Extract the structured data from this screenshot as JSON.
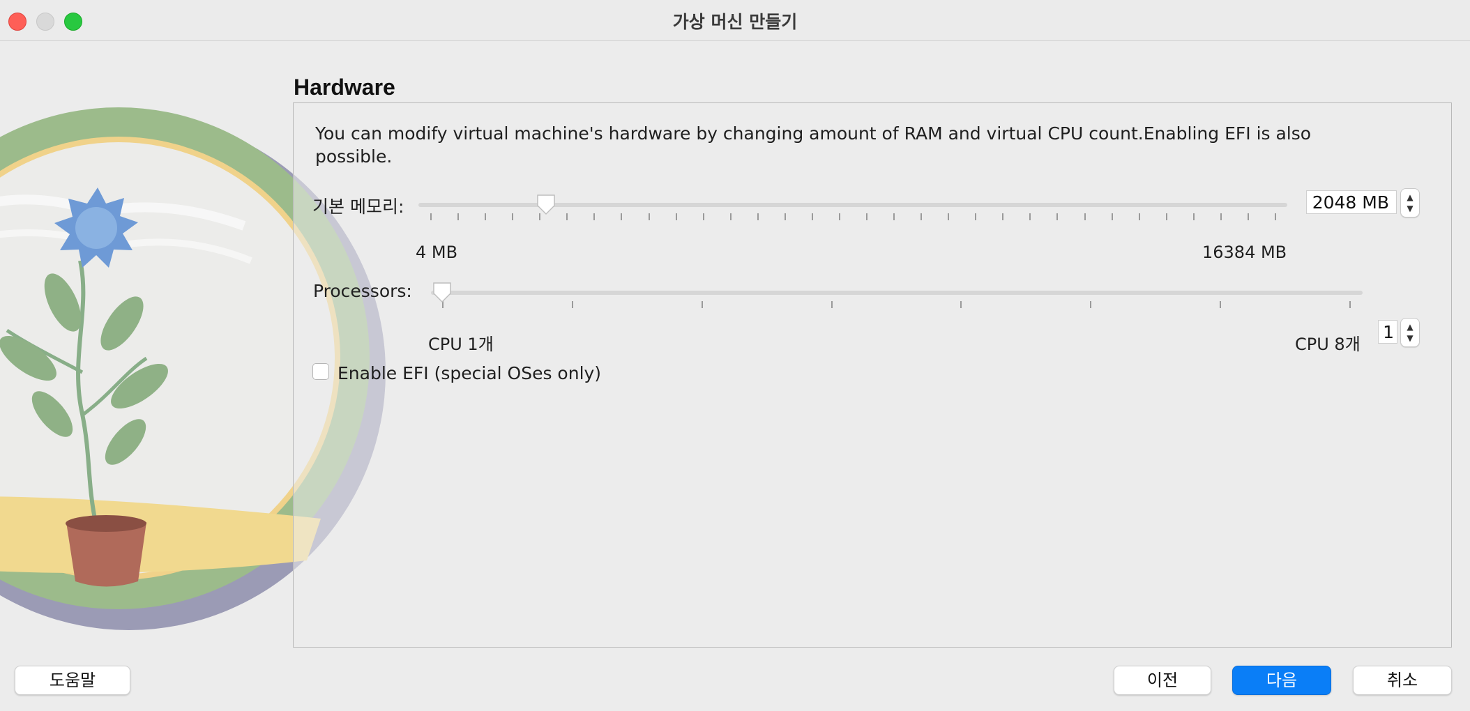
{
  "window": {
    "title": "가상 머신 만들기"
  },
  "page": {
    "title": "Hardware",
    "description": "You can modify virtual machine's hardware by changing amount of RAM and virtual CPU count.Enabling EFI is also possible."
  },
  "memory": {
    "label": "기본 메모리:",
    "value_text": "2048 MB",
    "value_mb": 2048,
    "min_label": "4 MB",
    "max_label": "16384 MB",
    "min_mb": 4,
    "max_mb": 16384
  },
  "processors": {
    "label": "Processors:",
    "value_text": "1",
    "value": 1,
    "min_label": "CPU 1개",
    "max_label": "CPU 8개",
    "min": 1,
    "max": 8
  },
  "efi": {
    "label": "Enable EFI (special OSes only)",
    "checked": false
  },
  "buttons": {
    "help": "도움말",
    "back": "이전",
    "next": "다음",
    "cancel": "취소"
  },
  "icons": {
    "spin_up": "chevron-up-icon",
    "spin_down": "chevron-down-icon"
  },
  "colors": {
    "accent": "#0a7ef7",
    "close": "#fe5f57",
    "zoom": "#28c840"
  }
}
